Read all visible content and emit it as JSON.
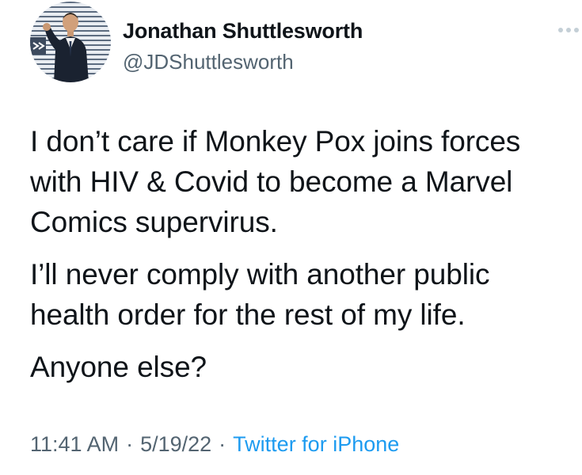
{
  "tweet": {
    "author": {
      "display_name": "Jonathan Shuttlesworth",
      "handle": "@JDShuttlesworth"
    },
    "paragraphs": [
      "I don’t care if Monkey Pox joins forces with HIV & Covid to become a Marvel Comics supervirus.",
      "I’ll never comply with another public health order for the rest of my life.",
      "Anyone else?"
    ],
    "time": "11:41 AM",
    "date": "5/19/22",
    "separator": "·",
    "source": "Twitter for iPhone"
  },
  "icons": {
    "avatar": "profile-photo",
    "more": "more-dots-icon"
  },
  "colors": {
    "text": "#0f1419",
    "secondary": "#536471",
    "link": "#1d9bf0",
    "background": "#ffffff"
  }
}
